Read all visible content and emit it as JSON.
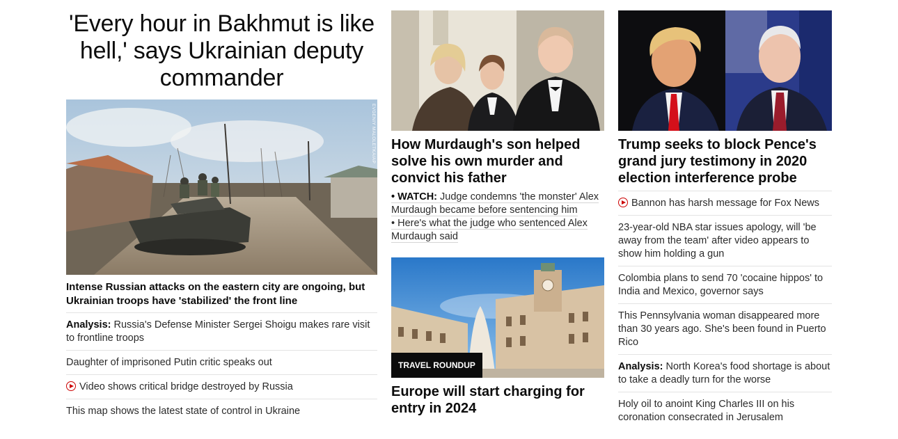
{
  "lead": {
    "headline": "'Every hour in Bakhmut is like hell,' says Ukrainian deputy commander",
    "photo_credit": "EVGENIY MALOLETKA/AP",
    "story_title": "Intense Russian attacks on the eastern city are ongoing, but Ukrainian troops have 'stabilized' the front line",
    "links": [
      {
        "prefix": "Analysis:",
        "text": "Russia's Defense Minister Sergei Shoigu makes rare visit to frontline troops",
        "icon": ""
      },
      {
        "prefix": "",
        "text": "Daughter of imprisoned Putin critic speaks out",
        "icon": ""
      },
      {
        "prefix": "",
        "text": "Video shows critical bridge destroyed by Russia",
        "icon": "play-icon"
      },
      {
        "prefix": "",
        "text": "This map shows the latest state of control in Ukraine",
        "icon": ""
      }
    ]
  },
  "murdaugh": {
    "title": "How Murdaugh's son helped solve his own murder and convict his father",
    "links": [
      {
        "prefix": "• WATCH:",
        "text": "Judge condemns 'the monster' Alex Murdaugh became before sentencing him"
      },
      {
        "prefix": "•",
        "text": "Here's what the judge who sentenced Alex Murdaugh said"
      }
    ]
  },
  "europe": {
    "badge": "TRAVEL ROUNDUP",
    "title": "Europe will start charging for entry in 2024"
  },
  "trump": {
    "title": "Trump seeks to block Pence's grand jury testimony in 2020 election interference probe",
    "links": [
      {
        "prefix": "",
        "text": "Bannon has harsh message for Fox News",
        "icon": "play-icon"
      },
      {
        "prefix": "",
        "text": "23-year-old NBA star issues apology, will 'be away from the team' after video appears to show him holding a gun",
        "icon": ""
      },
      {
        "prefix": "",
        "text": "Colombia plans to send 70 'cocaine hippos' to India and Mexico, governor says",
        "icon": ""
      },
      {
        "prefix": "",
        "text": "This Pennsylvania woman disappeared more than 30 years ago. She's been found in Puerto Rico",
        "icon": ""
      },
      {
        "prefix": "Analysis:",
        "text": "North Korea's food shortage is about to take a deadly turn for the worse",
        "icon": ""
      },
      {
        "prefix": "",
        "text": "Holy oil to anoint King Charles III on his coronation consecrated in Jerusalem",
        "icon": ""
      }
    ]
  },
  "colors": {
    "text": "#0c0c0c",
    "secondary_text": "#2b2b2b",
    "divider": "#e3e3e3",
    "video_red": "#cc0000",
    "badge_bg": "#0c0c0c"
  }
}
